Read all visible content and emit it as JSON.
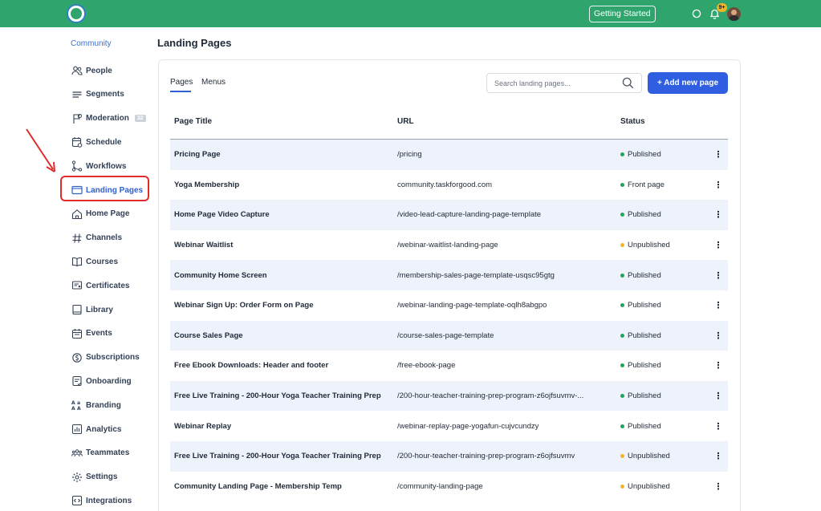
{
  "topbar": {
    "getting_started_label": "Getting Started",
    "notification_badge": "9+"
  },
  "sidebar": {
    "section_label": "Community",
    "items": [
      {
        "label": "People",
        "icon": "people-icon"
      },
      {
        "label": "Segments",
        "icon": "segments-icon"
      },
      {
        "label": "Moderation",
        "icon": "moderation-icon",
        "badge": "32"
      },
      {
        "label": "Schedule",
        "icon": "schedule-icon"
      },
      {
        "label": "Workflows",
        "icon": "workflows-icon"
      },
      {
        "label": "Landing Pages",
        "icon": "landing-pages-icon",
        "active": true
      },
      {
        "label": "Home Page",
        "icon": "home-icon"
      },
      {
        "label": "Channels",
        "icon": "hash-icon"
      },
      {
        "label": "Courses",
        "icon": "book-open-icon"
      },
      {
        "label": "Certificates",
        "icon": "certificate-icon"
      },
      {
        "label": "Library",
        "icon": "library-icon"
      },
      {
        "label": "Events",
        "icon": "calendar-icon"
      },
      {
        "label": "Subscriptions",
        "icon": "subscriptions-icon"
      },
      {
        "label": "Onboarding",
        "icon": "onboarding-icon"
      },
      {
        "label": "Branding",
        "icon": "branding-icon"
      },
      {
        "label": "Analytics",
        "icon": "analytics-icon"
      },
      {
        "label": "Teammates",
        "icon": "teammates-icon"
      },
      {
        "label": "Settings",
        "icon": "gear-icon"
      },
      {
        "label": "Integrations",
        "icon": "integrations-icon"
      }
    ]
  },
  "main": {
    "title": "Landing Pages",
    "tabs": [
      {
        "label": "Pages",
        "active": true
      },
      {
        "label": "Menus",
        "active": false
      }
    ],
    "search_placeholder": "Search landing pages...",
    "add_button_label": "+ Add new page",
    "table": {
      "headers": [
        "Page Title",
        "URL",
        "Status"
      ],
      "rows": [
        {
          "title": "Pricing Page",
          "url": "/pricing",
          "status": "Published"
        },
        {
          "title": "Yoga Membership",
          "url": "community.taskforgood.com",
          "status": "Front page"
        },
        {
          "title": "Home Page Video Capture",
          "url": "/video-lead-capture-landing-page-template",
          "status": "Published"
        },
        {
          "title": "Webinar Waitlist",
          "url": "/webinar-waitlist-landing-page",
          "status": "Unpublished"
        },
        {
          "title": "Community Home Screen",
          "url": "/membership-sales-page-template-usqsc95gtg",
          "status": "Published"
        },
        {
          "title": "Webinar Sign Up: Order Form on Page",
          "url": "/webinar-landing-page-template-oqlh8abgpo",
          "status": "Published"
        },
        {
          "title": "Course Sales Page",
          "url": "/course-sales-page-template",
          "status": "Published"
        },
        {
          "title": "Free Ebook Downloads: Header and footer",
          "url": "/free-ebook-page",
          "status": "Published"
        },
        {
          "title": "Free Live Training - 200-Hour Yoga Teacher Training Prep",
          "url": "/200-hour-teacher-training-prep-program-z6ojfsuvmv-...",
          "status": "Published"
        },
        {
          "title": "Webinar Replay",
          "url": "/webinar-replay-page-yogafun-cujvcundzy",
          "status": "Published"
        },
        {
          "title": "Free Live Training - 200-Hour Yoga Teacher Training Prep",
          "url": "/200-hour-teacher-training-prep-program-z6ojfsuvmv",
          "status": "Unpublished"
        },
        {
          "title": "Community Landing Page - Membership Temp",
          "url": "/community-landing-page",
          "status": "Unpublished"
        }
      ]
    }
  },
  "colors": {
    "brand_green": "#2fa56d",
    "accent_blue": "#2f5fe0",
    "published": "#22a55b",
    "unpublished": "#f0b429",
    "highlight_red": "#e02b2b"
  }
}
